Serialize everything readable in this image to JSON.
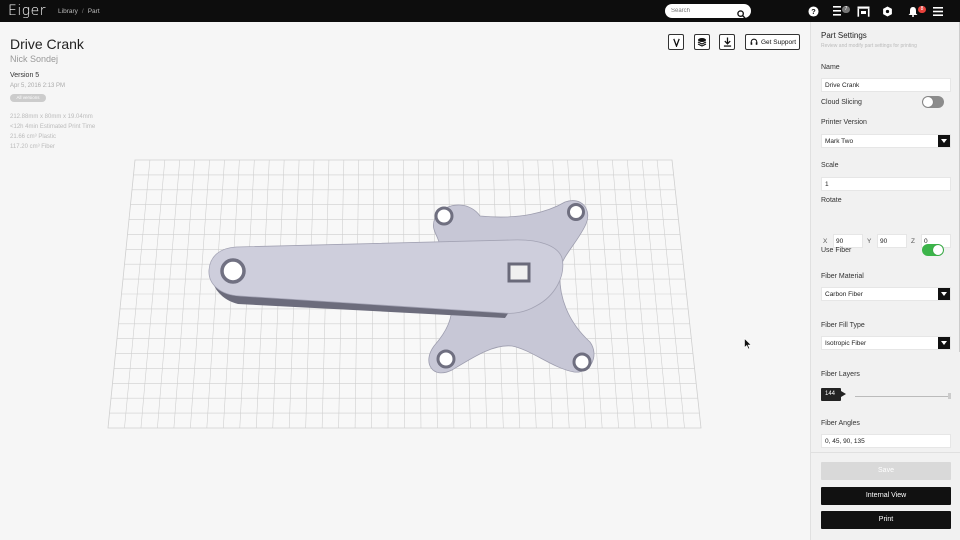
{
  "app": {
    "name": "Eiger"
  },
  "breadcrumb": [
    "Library",
    "Part"
  ],
  "search": {
    "placeholder": "Search"
  },
  "topbar": {
    "list_badge": "7",
    "alerts_badge": "8"
  },
  "part": {
    "title": "Drive Crank",
    "owner": "Nick Sondej",
    "version": "Version 5",
    "date": "Apr 5, 2016 2:13 PM",
    "tag": "All versions",
    "stats": [
      "212.88mm x 80mm x 19.04mm",
      "<12h 4min Estimated Print Time",
      "21.66 cm³ Plastic",
      "117.20 cm³ Fiber"
    ]
  },
  "actions": {
    "support": "Get Support"
  },
  "settings": {
    "title": "Part Settings",
    "subtitle": "Review and modify part settings for printing",
    "name_label": "Name",
    "name_value": "Drive Crank",
    "cloud_slicing_label": "Cloud Slicing",
    "cloud_slicing": false,
    "printer_label": "Printer Version",
    "printer_value": "Mark Two",
    "scale_label": "Scale",
    "scale_value": "1",
    "rotate_label": "Rotate",
    "rotate": {
      "x_label": "X",
      "x": "90",
      "y_label": "Y",
      "y": "90",
      "z_label": "Z",
      "z": "0"
    },
    "use_fiber_label": "Use Fiber",
    "use_fiber": true,
    "fiber_material_label": "Fiber Material",
    "fiber_material": "Carbon Fiber",
    "fiber_fill_label": "Fiber Fill Type",
    "fiber_fill": "Isotropic Fiber",
    "fiber_layers_label": "Fiber Layers",
    "fiber_layers": "144",
    "fiber_angles_label": "Fiber Angles",
    "fiber_angles": "0, 45, 90, 135",
    "save_label": "Save",
    "internal_view_label": "Internal View",
    "print_label": "Print"
  },
  "colors": {
    "toggle_on": "#3cb44a",
    "toggle_off": "#8c8c8c",
    "part": "#c9c9d8",
    "badge_list": "#777777",
    "badge_alert": "#e8413b"
  }
}
